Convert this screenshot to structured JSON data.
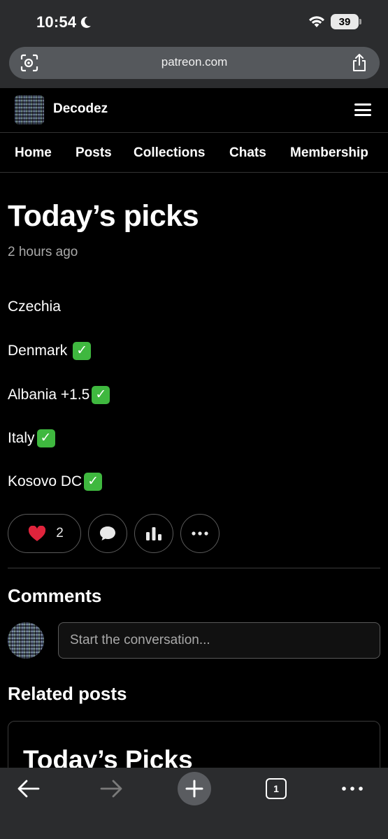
{
  "status_bar": {
    "time": "10:54",
    "battery": "39"
  },
  "browser": {
    "url": "patreon.com"
  },
  "header": {
    "creator_name": "Decodez"
  },
  "nav": {
    "tabs": [
      "Home",
      "Posts",
      "Collections",
      "Chats",
      "Membership"
    ]
  },
  "post": {
    "title": "Today’s picks",
    "time": "2 hours ago",
    "picks": [
      {
        "text": "Czechia",
        "check": false
      },
      {
        "text": "Denmark",
        "check": true
      },
      {
        "text": "Albania +1.5",
        "check": true
      },
      {
        "text": "Italy",
        "check": true
      },
      {
        "text": "Kosovo DC",
        "check": true
      }
    ],
    "like_count": "2",
    "check_glyph": "✓"
  },
  "comments": {
    "heading": "Comments",
    "placeholder": "Start the conversation..."
  },
  "related": {
    "heading": "Related posts",
    "card_title": "Today’s Picks"
  },
  "colors": {
    "background": "#000000",
    "chrome": "#2b2c2e",
    "like_heart": "#e0243c",
    "check_green": "#3fb83f"
  },
  "icons": [
    "moon-icon",
    "wifi-icon",
    "lens-icon",
    "share-icon",
    "menu-icon",
    "heart-icon",
    "comment-icon",
    "stats-icon",
    "more-icon",
    "back-arrow-icon",
    "forward-arrow-icon",
    "plus-icon",
    "tabs-icon"
  ]
}
